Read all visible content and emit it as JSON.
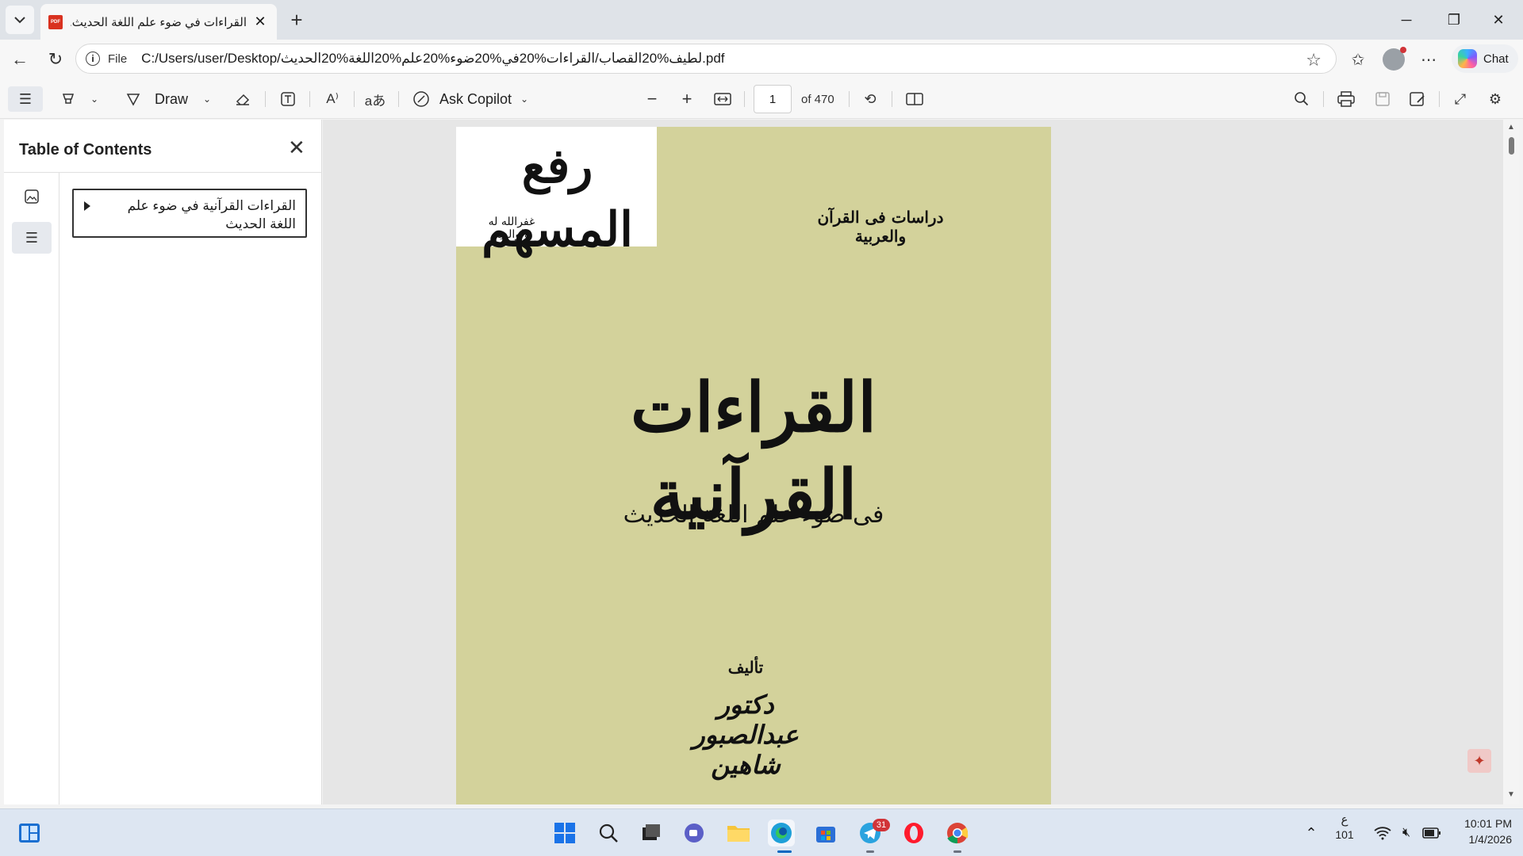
{
  "browser": {
    "tab": {
      "title": "القراءات في ضوء علم اللغة الحديث.pdf",
      "favicon": "PDF"
    },
    "address": {
      "scheme": "File",
      "url": "C:/Users/user/Desktop/لطيف%20القصاب/القراءات%20في%20ضوء%20علم%20اللغة%20الحديث.pdf"
    },
    "copilot_label": "Chat"
  },
  "pdf_toolbar": {
    "draw_label": "Draw",
    "ask_copilot_label": "Ask Copilot",
    "page_current": "1",
    "page_total_label": "of 470"
  },
  "side_panel": {
    "title": "Table of Contents",
    "toc_items": [
      {
        "label": "القراءات القرآنية في ضوء علم اللغة الحديث"
      }
    ]
  },
  "document": {
    "stamp_main": "رفع المسهم",
    "stamp_sub": "غفرالله له ولوالديه",
    "series": "دراسات فى القرآن والعربية",
    "title": "القراءات القرآنية",
    "subtitle": "فى ضوء علم اللغة الحديث",
    "author_label": "تأليف",
    "author_name": "دكتور عبدالصبور شاهين"
  },
  "taskbar": {
    "telegram_badge": "31",
    "lang_line1": "ع",
    "lang_line2": "101",
    "time": "10:01 PM",
    "date": "1/4/2026"
  },
  "colors": {
    "page_bg": "#d3d29b",
    "accent": "#0067c0"
  }
}
